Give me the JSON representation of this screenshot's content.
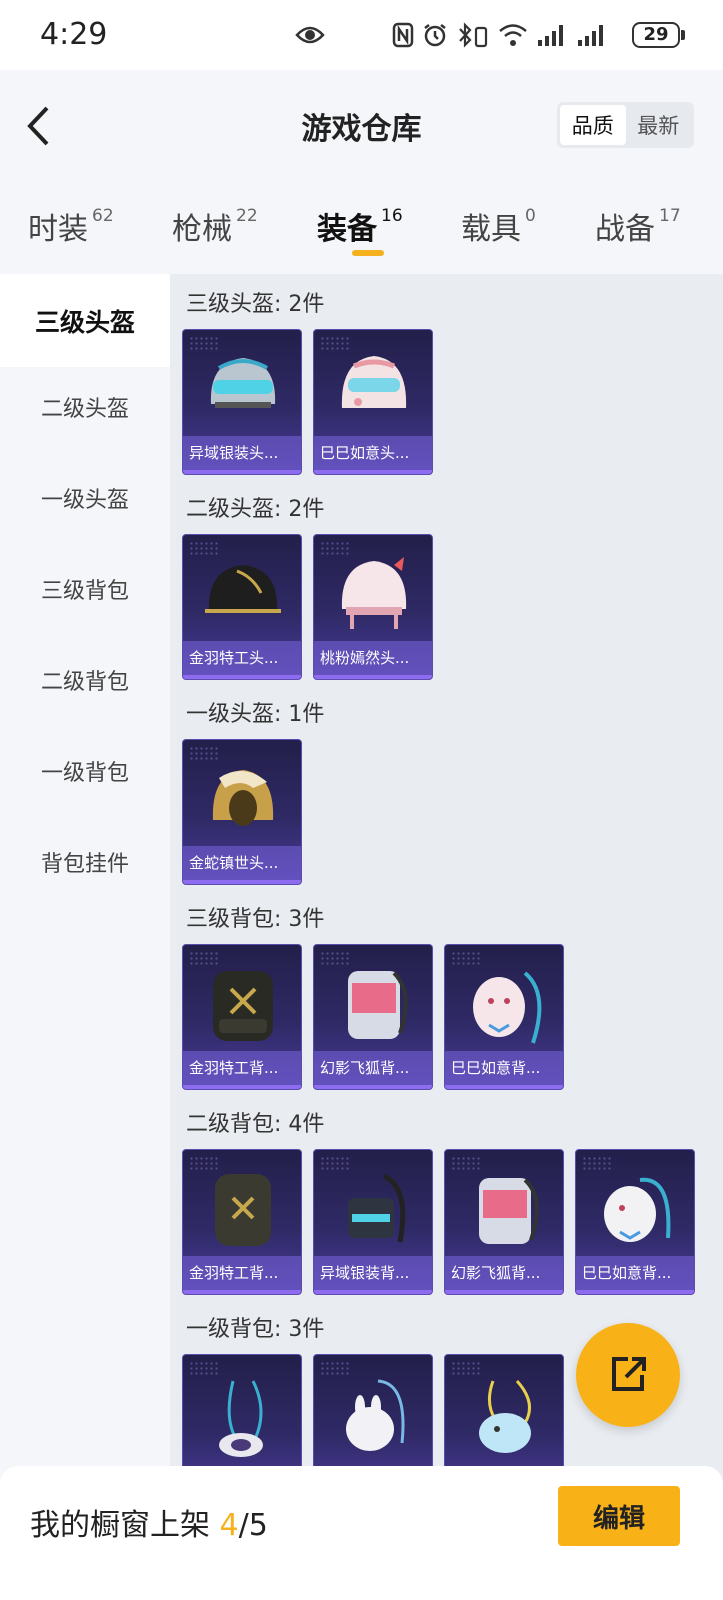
{
  "status_bar": {
    "time": "4:29",
    "battery": "29"
  },
  "header": {
    "title": "游戏仓库",
    "sort_options": [
      "品质",
      "最新"
    ],
    "active_sort": "品质"
  },
  "tabs": [
    {
      "label": "时装",
      "count": "62"
    },
    {
      "label": "枪械",
      "count": "22"
    },
    {
      "label": "装备",
      "count": "16",
      "active": true
    },
    {
      "label": "载具",
      "count": "0"
    },
    {
      "label": "战备",
      "count": "17"
    }
  ],
  "sidebar": {
    "items": [
      "三级头盔",
      "二级头盔",
      "一级头盔",
      "三级背包",
      "二级背包",
      "一级背包",
      "背包挂件"
    ],
    "active": "三级头盔"
  },
  "sections": [
    {
      "title": "三级头盔: 2件",
      "items": [
        {
          "name": "异域银装头...",
          "icon": "helmet-cyan-icon"
        },
        {
          "name": "巳巳如意头...",
          "icon": "helmet-pink-icon"
        }
      ]
    },
    {
      "title": "二级头盔: 2件",
      "items": [
        {
          "name": "金羽特工头...",
          "icon": "helmet-black-gold-icon"
        },
        {
          "name": "桃粉嫣然头...",
          "icon": "helmet-peach-icon"
        }
      ]
    },
    {
      "title": "一级头盔: 1件",
      "items": [
        {
          "name": "金蛇镇世头...",
          "icon": "helmet-gold-icon"
        }
      ]
    },
    {
      "title": "三级背包: 3件",
      "items": [
        {
          "name": "金羽特工背...",
          "icon": "backpack-black-gold-icon"
        },
        {
          "name": "幻影飞狐背...",
          "icon": "backpack-pink-fox-icon"
        },
        {
          "name": "巳巳如意背...",
          "icon": "backpack-pink-snake-icon"
        }
      ]
    },
    {
      "title": "二级背包: 4件",
      "items": [
        {
          "name": "金羽特工背...",
          "icon": "backpack-black-gold-icon"
        },
        {
          "name": "异域银装背...",
          "icon": "backpack-cyan-icon"
        },
        {
          "name": "幻影飞狐背...",
          "icon": "backpack-pink-fox-icon"
        },
        {
          "name": "巳巳如意背...",
          "icon": "backpack-white-icon"
        }
      ]
    },
    {
      "title": "一级背包: 3件",
      "items": [
        {
          "name": "",
          "icon": "backpack-strap-icon"
        },
        {
          "name": "",
          "icon": "backpack-bunny-icon"
        },
        {
          "name": "",
          "icon": "backpack-fish-icon"
        }
      ]
    }
  ],
  "bottom_bar": {
    "label": "我的橱窗上架",
    "shelf_count": "4",
    "shelf_total": "/5",
    "edit_label": "编辑"
  },
  "colors": {
    "accent": "#f8b218",
    "card_top": "#231f4a",
    "card_bottom": "#4a3a9a",
    "caption": "#7864dc"
  }
}
